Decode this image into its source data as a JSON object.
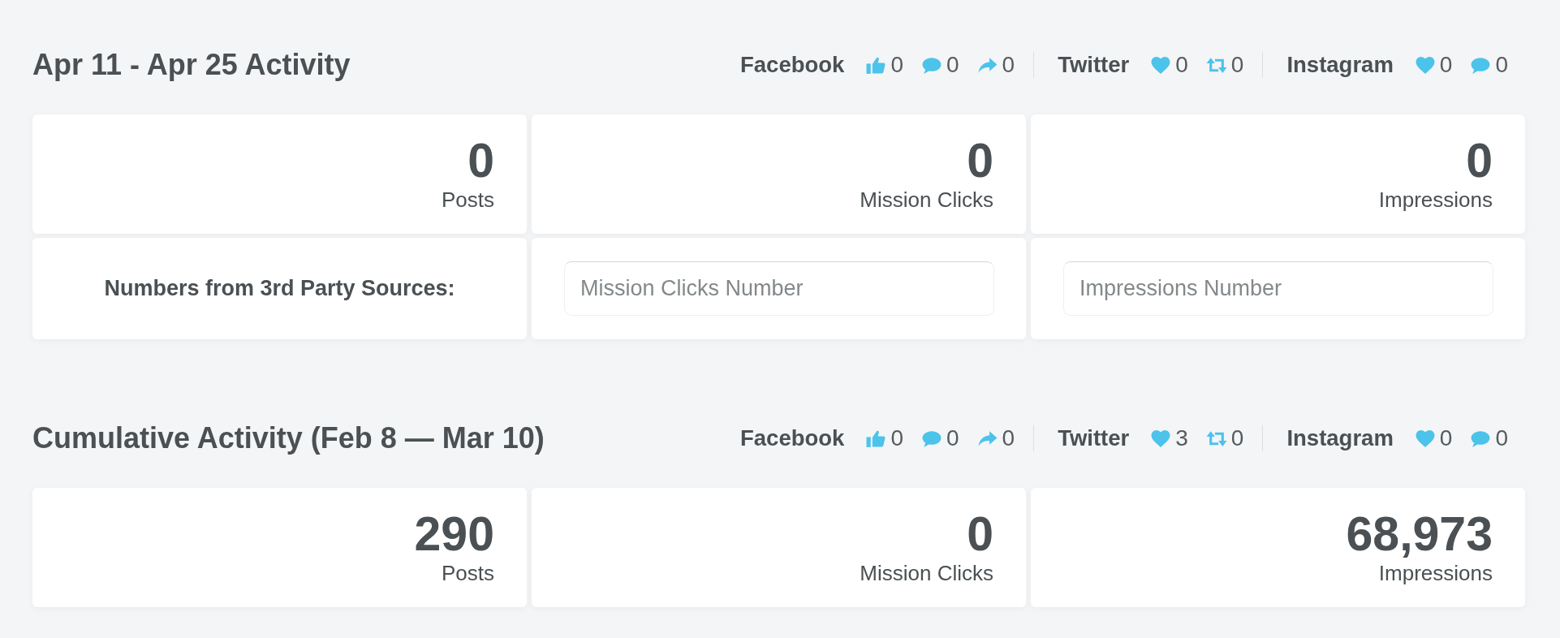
{
  "sections": [
    {
      "title": "Apr 11 - Apr 25 Activity",
      "networks": [
        {
          "name": "Facebook",
          "metrics": [
            {
              "kind": "like",
              "count": "0"
            },
            {
              "kind": "comment",
              "count": "0"
            },
            {
              "kind": "share",
              "count": "0"
            }
          ]
        },
        {
          "name": "Twitter",
          "metrics": [
            {
              "kind": "heart",
              "count": "0"
            },
            {
              "kind": "retweet",
              "count": "0"
            }
          ]
        },
        {
          "name": "Instagram",
          "metrics": [
            {
              "kind": "heart",
              "count": "0"
            },
            {
              "kind": "comment",
              "count": "0"
            }
          ]
        }
      ],
      "stats": [
        {
          "value": "0",
          "label": "Posts"
        },
        {
          "value": "0",
          "label": "Mission Clicks"
        },
        {
          "value": "0",
          "label": "Impressions"
        }
      ],
      "third_party": {
        "label": "Numbers from 3rd Party Sources:",
        "fields": [
          {
            "placeholder": "Mission Clicks Number"
          },
          {
            "placeholder": "Impressions Number"
          }
        ]
      }
    },
    {
      "title": "Cumulative Activity (Feb 8 — Mar 10)",
      "networks": [
        {
          "name": "Facebook",
          "metrics": [
            {
              "kind": "like",
              "count": "0"
            },
            {
              "kind": "comment",
              "count": "0"
            },
            {
              "kind": "share",
              "count": "0"
            }
          ]
        },
        {
          "name": "Twitter",
          "metrics": [
            {
              "kind": "heart",
              "count": "3"
            },
            {
              "kind": "retweet",
              "count": "0"
            }
          ]
        },
        {
          "name": "Instagram",
          "metrics": [
            {
              "kind": "heart",
              "count": "0"
            },
            {
              "kind": "comment",
              "count": "0"
            }
          ]
        }
      ],
      "stats": [
        {
          "value": "290",
          "label": "Posts"
        },
        {
          "value": "0",
          "label": "Mission Clicks"
        },
        {
          "value": "68,973",
          "label": "Impressions"
        }
      ]
    }
  ]
}
